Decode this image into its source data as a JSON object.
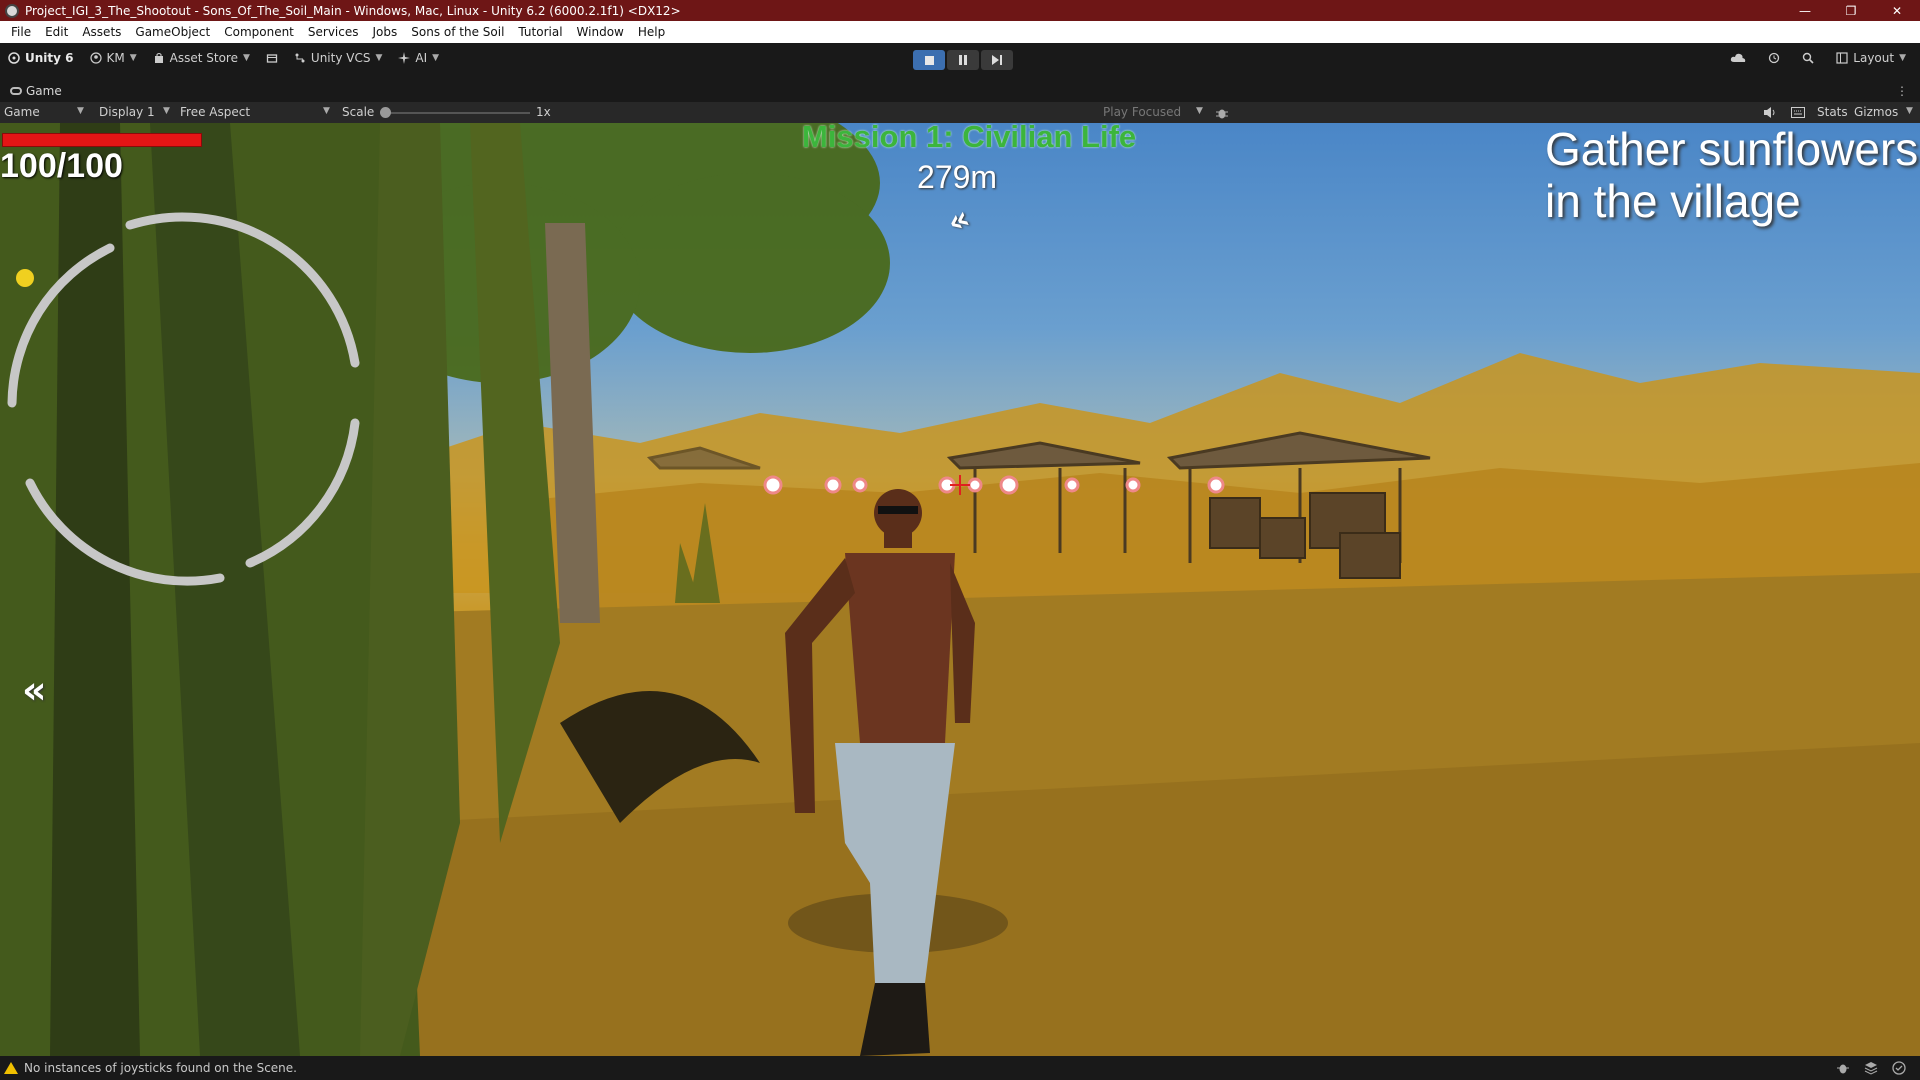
{
  "window": {
    "title": "Project_IGI_3_The_Shootout - Sons_Of_The_Soil_Main - Windows, Mac, Linux - Unity 6.2 (6000.2.1f1) <DX12>",
    "controls": [
      "—",
      "❐",
      "✕"
    ]
  },
  "menu": {
    "items": [
      "File",
      "Edit",
      "Assets",
      "GameObject",
      "Component",
      "Services",
      "Jobs",
      "Sons of the Soil",
      "Tutorial",
      "Window",
      "Help"
    ]
  },
  "toolbar": {
    "unity_label": "Unity 6",
    "account_label": "KM",
    "asset_store_label": "Asset Store",
    "vcs_label": "Unity VCS",
    "ai_label": "AI",
    "layout_label": "Layout",
    "play_state": "playing"
  },
  "game_tab": {
    "label": "Game"
  },
  "game_bar": {
    "view_mode": "Game",
    "display": "Display 1",
    "aspect": "Free Aspect",
    "scale_label": "Scale",
    "scale_value": "1x",
    "play_mode": "Play Focused",
    "stats_label": "Stats",
    "gizmos_label": "Gizmos"
  },
  "hud": {
    "health_text": "100/100",
    "health_fraction": 1.0,
    "mission_title": "Mission 1: Civilian Life",
    "distance": "279m",
    "objective_line1": "Gather sunflowers",
    "objective_line2": "in the village",
    "left_arrow": "«",
    "top_arrow": "«"
  },
  "status": {
    "message": "No instances of joysticks found on the Scene."
  },
  "colors": {
    "title_bar": "#6e1616",
    "health": "#e41515",
    "mission_green": "#3cb53c",
    "play_active": "#3c6fb0"
  }
}
